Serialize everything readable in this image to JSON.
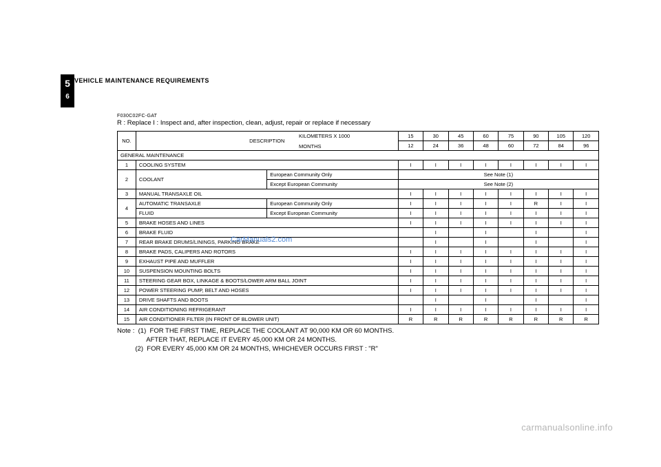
{
  "chapter_number": "5",
  "page_number": "6",
  "header_title": "VEHICLE  MAINTENANCE  REQUIREMENTS",
  "code": "F030C02FC-GAT",
  "legend": "R : Replace        I  : Inspect and, after inspection, clean, adjust, repair or replace if necessary",
  "head": {
    "no": "NO.",
    "desc": "DESCRIPTION",
    "km_label": "KILOMETERS X 1000",
    "mo_label": "MONTHS",
    "km": [
      "15",
      "30",
      "45",
      "60",
      "75",
      "90",
      "105",
      "120"
    ],
    "mo": [
      "12",
      "24",
      "36",
      "48",
      "60",
      "72",
      "84",
      "96"
    ]
  },
  "section_label": "GENERAL  MAINTENANCE",
  "rows": {
    "r1": {
      "no": "1",
      "desc": "COOLING  SYSTEM",
      "v": [
        "I",
        "I",
        "I",
        "I",
        "I",
        "I",
        "I",
        "I"
      ]
    },
    "r2a": {
      "no": "2",
      "desc": "COOLANT",
      "sub": "European  Community  Only",
      "note": "See  Note  (1)"
    },
    "r2b": {
      "sub": "Except  European  Community",
      "note": "See  Note  (2)"
    },
    "r3": {
      "no": "3",
      "desc": "MANUAL  TRANSAXLE  OIL",
      "v": [
        "I",
        "I",
        "I",
        "I",
        "I",
        "I",
        "I",
        "I"
      ]
    },
    "r4a": {
      "no": "4",
      "desc": "AUTOMATIC  TRANSAXLE",
      "sub": "European  Community  Only",
      "v": [
        "I",
        "I",
        "I",
        "I",
        "I",
        "R",
        "I",
        "I"
      ]
    },
    "r4b": {
      "desc": "FLUID",
      "sub": "Except  European  Community",
      "v": [
        "I",
        "I",
        "I",
        "I",
        "I",
        "I",
        "I",
        "I"
      ]
    },
    "r5": {
      "no": "5",
      "desc": "BRAKE  HOSES  AND  LINES",
      "v": [
        "I",
        "I",
        "I",
        "I",
        "I",
        "I",
        "I",
        "I"
      ]
    },
    "r6": {
      "no": "6",
      "desc": "BRAKE  FLUID",
      "v": [
        "",
        "I",
        "",
        "I",
        "",
        "I",
        "",
        "I"
      ]
    },
    "r7": {
      "no": "7",
      "desc": "REAR  BRAKE  DRUMS/LININGS,  PARKING  BRAKE",
      "v": [
        "",
        "I",
        "",
        "I",
        "",
        "I",
        "",
        "I"
      ]
    },
    "r8": {
      "no": "8",
      "desc": "BRAKE  PADS,  CALIPERS  AND  ROTORS",
      "v": [
        "I",
        "I",
        "I",
        "I",
        "I",
        "I",
        "I",
        "I"
      ]
    },
    "r9": {
      "no": "9",
      "desc": "EXHAUST  PIPE  AND  MUFFLER",
      "v": [
        "I",
        "I",
        "I",
        "I",
        "I",
        "I",
        "I",
        "I"
      ]
    },
    "r10": {
      "no": "10",
      "desc": "SUSPENSION  MOUNTING  BOLTS",
      "v": [
        "I",
        "I",
        "I",
        "I",
        "I",
        "I",
        "I",
        "I"
      ]
    },
    "r11": {
      "no": "11",
      "desc": "STEERING  GEAR  BOX,  LINKAGE  &    BOOTS/LOWER  ARM  BALL  JOINT",
      "v": [
        "I",
        "I",
        "I",
        "I",
        "I",
        "I",
        "I",
        "I"
      ]
    },
    "r12": {
      "no": "12",
      "desc": "POWER  STEERING  PUMP,  BELT  AND  HOSES",
      "v": [
        "I",
        "I",
        "I",
        "I",
        "I",
        "I",
        "I",
        "I"
      ]
    },
    "r13": {
      "no": "13",
      "desc": "DRIVE  SHAFTS  AND  BOOTS",
      "v": [
        "",
        "I",
        "",
        "I",
        "",
        "I",
        "",
        "I"
      ]
    },
    "r14": {
      "no": "14",
      "desc": "AIR  CONDITIONING  REFRIGERANT",
      "v": [
        "I",
        "I",
        "I",
        "I",
        "I",
        "I",
        "I",
        "I"
      ]
    },
    "r15": {
      "no": "15",
      "desc": "AIR  CONDITIONER  FILTER  (IN  FRONT  OF  BLOWER  UNIT)",
      "v": [
        "R",
        "R",
        "R",
        "R",
        "R",
        "R",
        "R",
        "R"
      ]
    }
  },
  "footnote": {
    "l1": "Note :  (1)  FOR THE FIRST TIME, REPLACE THE COOLANT AT 90,000 KM OR 60 MONTHS.",
    "l2": "                AFTER THAT, REPLACE IT EVERY 45,000 KM OR 24 MONTHS.",
    "l3": "          (2)  FOR EVERY 45,000 KM OR 24 MONTHS, WHICHEVER OCCURS FIRST : \"R\""
  },
  "watermark_center": "CarManuals2.com",
  "watermark_bottom": "carmanualsonline.info"
}
